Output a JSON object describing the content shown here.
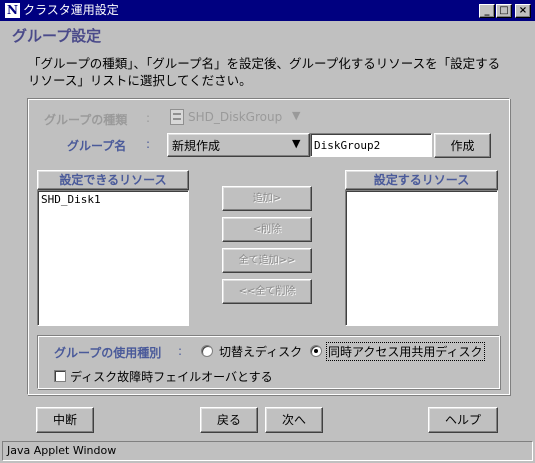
{
  "window": {
    "title": "クラスタ運用設定",
    "icon_letter": "N",
    "minimize": "_",
    "maximize": "□",
    "close": "×"
  },
  "page": {
    "heading": "グループ設定",
    "description_line1": "「グループの種類」、「グループ名」を設定後、グループ化するリソースを「設定する",
    "description_line2": "リソース」リストに選択してください。"
  },
  "form": {
    "group_type_label": "グループの種類",
    "group_type_value": "SHD_DiskGroup",
    "group_name_label": "グループ名",
    "colon": ":",
    "group_name_select": "新規作成",
    "group_name_input": "DiskGroup2",
    "create_button": "作成"
  },
  "lists": {
    "available_header": "設定できるリソース",
    "available_items": [
      "SHD_Disk1"
    ],
    "selected_header": "設定するリソース",
    "selected_items": []
  },
  "transfer_buttons": {
    "add": "追加>",
    "remove": "<削除",
    "add_all": "全て追加>>",
    "remove_all": "<<全て削除"
  },
  "usage": {
    "label": "グループの使用種別",
    "option_switch": "切替えディスク",
    "option_shared": "同時アクセス用共用ディスク",
    "selected": "option_shared",
    "failover_checkbox": "ディスク故障時フェイルオーバとする",
    "failover_checked": false
  },
  "footer": {
    "abort": "中断",
    "back": "戻る",
    "next": "次へ",
    "help": "ヘルプ"
  },
  "status_bar": "Java Applet Window"
}
